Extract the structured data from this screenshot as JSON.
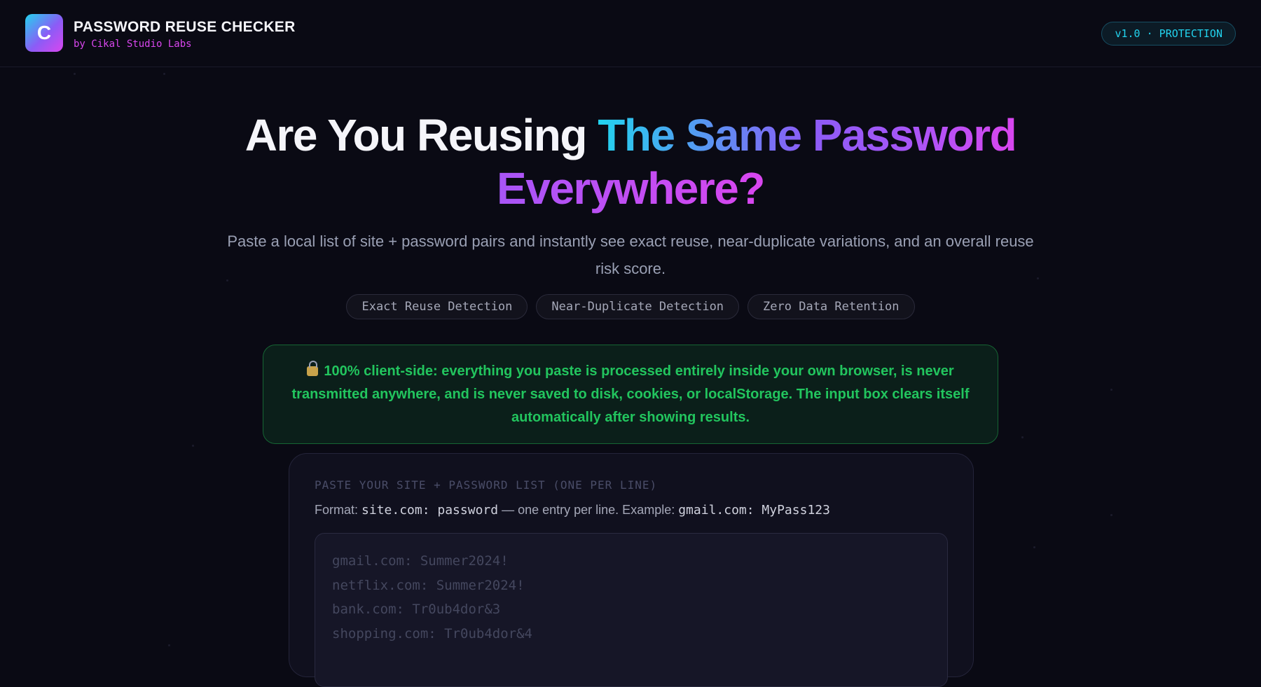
{
  "header": {
    "logo_letter": "C",
    "title": "PASSWORD REUSE CHECKER",
    "subtitle": "by Cikal Studio Labs",
    "version_badge": "v1.0 · PROTECTION"
  },
  "hero": {
    "title_part1": "Are You Reusing ",
    "title_part2": "The Same Password",
    "title_part3": "Everywhere?",
    "description": "Paste a local list of site + password pairs and instantly see exact reuse, near-duplicate variations, and an overall reuse risk score."
  },
  "features": [
    "Exact Reuse Detection",
    "Near-Duplicate Detection",
    "Zero Data Retention"
  ],
  "privacy_notice": {
    "icon": "lock-icon",
    "text": "100% client-side: everything you paste is processed entirely inside your own browser, is never transmitted anywhere, and is never saved to disk, cookies, or localStorage. The input box clears itself automatically after showing results."
  },
  "input_card": {
    "label": "PASTE YOUR SITE + PASSWORD LIST (ONE PER LINE)",
    "format_prefix": "Format: ",
    "format_code": "site.com: password",
    "format_middle": " — one entry per line. Example: ",
    "format_example": "gmail.com: MyPass123",
    "placeholder": "gmail.com: Summer2024!\nnetflix.com: Summer2024!\nbank.com: Tr0ub4dor&3\nshopping.com: Tr0ub4dor&4",
    "value": ""
  },
  "colors": {
    "background": "#0a0a14",
    "accent_cyan": "#22d3ee",
    "accent_purple": "#8b5cf6",
    "accent_magenta": "#d946ef",
    "success_green": "#22c55e"
  }
}
